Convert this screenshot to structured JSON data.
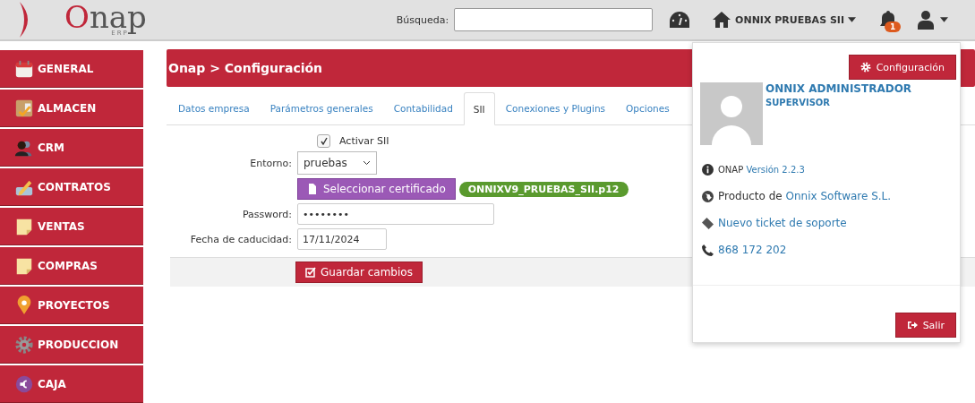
{
  "logo": {
    "accent": "O",
    "rest": "nap",
    "sub": "ERP"
  },
  "header": {
    "search_label": "Búsqueda:",
    "company": "ONNIX PRUEBAS SII",
    "notifications": "1"
  },
  "sidebar": {
    "items": [
      {
        "label": "GENERAL",
        "kind": "calendar"
      },
      {
        "label": "ALMACEN",
        "kind": "box"
      },
      {
        "label": "CRM",
        "kind": "people"
      },
      {
        "label": "CONTRATOS",
        "kind": "pencil"
      },
      {
        "label": "VENTAS",
        "kind": "note"
      },
      {
        "label": "COMPRAS",
        "kind": "note"
      },
      {
        "label": "PROYECTOS",
        "kind": "pin"
      },
      {
        "label": "PRODUCCION",
        "kind": "gear"
      },
      {
        "label": "CAJA",
        "kind": "euro"
      }
    ]
  },
  "page_title": "Onap > Configuración",
  "tabs": [
    {
      "label": "Datos empresa",
      "selected": false
    },
    {
      "label": "Parámetros generales",
      "selected": false
    },
    {
      "label": "Contabilidad",
      "selected": false
    },
    {
      "label": "SII",
      "selected": true
    },
    {
      "label": "Conexiones y Plugins",
      "selected": false
    },
    {
      "label": "Opciones",
      "selected": false
    }
  ],
  "form": {
    "activar": {
      "label": "Activar SII",
      "checked": true
    },
    "entorno": {
      "label": "Entorno:",
      "value": "pruebas"
    },
    "certificate_button": "Seleccionar certificado",
    "certificate_file": "ONNIXV9_PRUEBAS_SII.p12",
    "password": {
      "label": "Password:",
      "value": "••••••••"
    },
    "fecha": {
      "label": "Fecha de caducidad:",
      "value": "17/11/2024"
    },
    "save": "Guardar cambios"
  },
  "user_menu": {
    "config_button": "Configuración",
    "name": "ONNIX ADMINISTRADOR",
    "role": "SUPERVISOR",
    "version_prefix": "ONAP",
    "version_link": "Versión 2.2.3",
    "product_prefix": "Producto de",
    "product_link": "Onnix Software S.L.",
    "ticket_link": "Nuevo ticket de soporte",
    "phone": "868 172 202",
    "logout": "Salir"
  }
}
